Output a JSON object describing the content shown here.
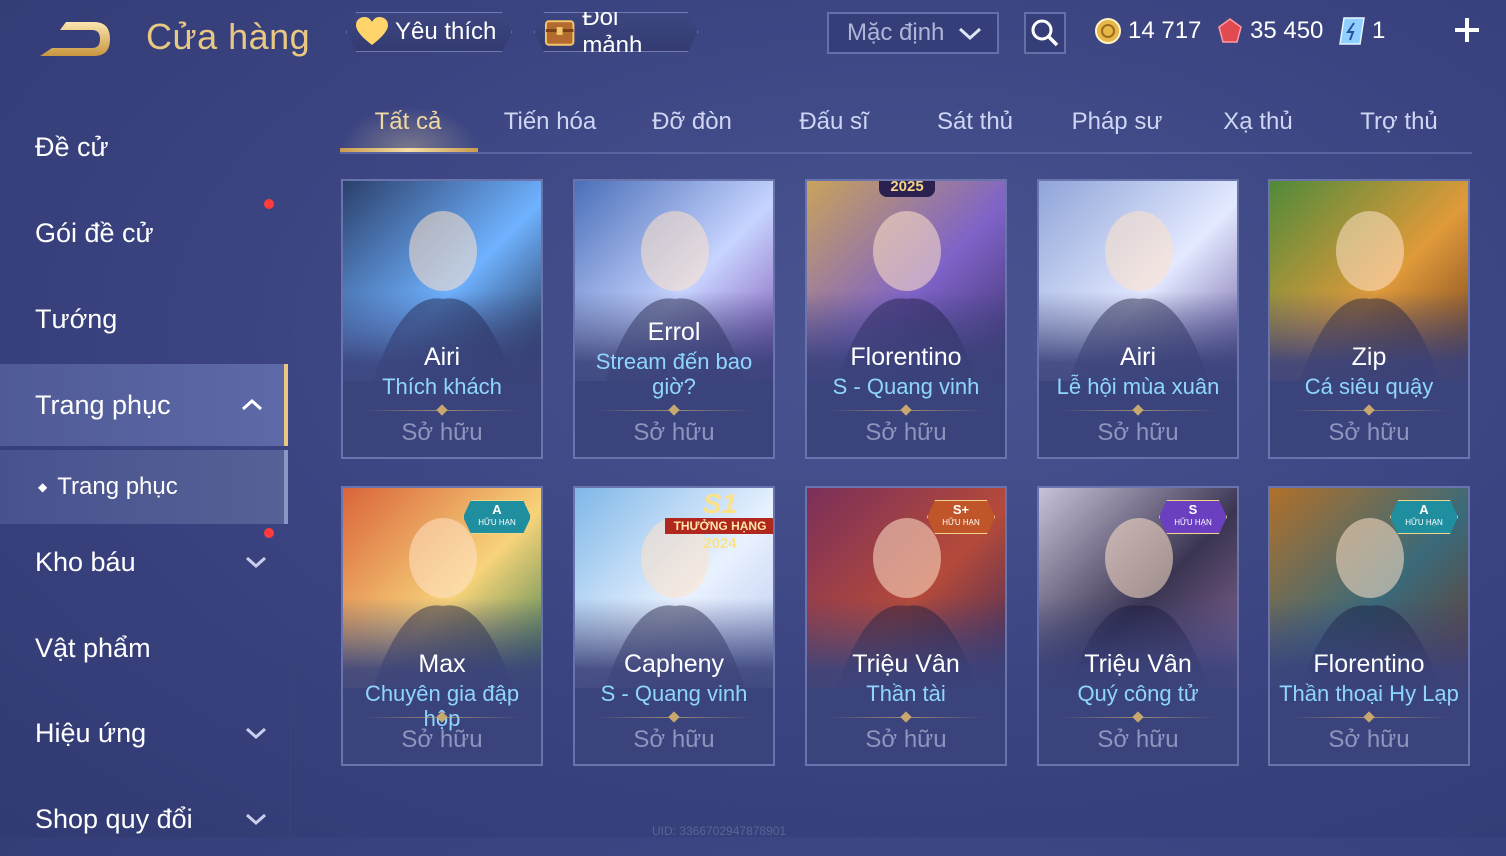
{
  "header": {
    "title": "Cửa hàng",
    "favorites_label": "Yêu thích",
    "exchange_label": "Đổi mảnh",
    "sort": {
      "selected": "Mặc định"
    },
    "currencies": {
      "gold": "14 717",
      "ruby": "35 450",
      "ticket": "1"
    }
  },
  "sidebar": {
    "items": [
      {
        "label": "Đề cử"
      },
      {
        "label": "Gói đề cử"
      },
      {
        "label": "Tướng"
      },
      {
        "label": "Trang phục"
      },
      {
        "label": "Trang phục"
      },
      {
        "label": "Kho báu"
      },
      {
        "label": "Vật phẩm"
      },
      {
        "label": "Hiệu ứng"
      },
      {
        "label": "Shop quy đổi"
      }
    ]
  },
  "tabs": [
    {
      "label": "Tất cả"
    },
    {
      "label": "Tiến hóa"
    },
    {
      "label": "Đỡ đòn"
    },
    {
      "label": "Đấu sĩ"
    },
    {
      "label": "Sát thủ"
    },
    {
      "label": "Pháp sư"
    },
    {
      "label": "Xạ thủ"
    },
    {
      "label": "Trợ thủ"
    }
  ],
  "cards": [
    {
      "hero": "Airi",
      "skin": "Thích khách",
      "status": "Sở hữu",
      "badge": ""
    },
    {
      "hero": "Errol",
      "skin": "Stream đến bao giờ?",
      "status": "Sở hữu",
      "badge": ""
    },
    {
      "hero": "Florentino",
      "skin": "S - Quang vinh",
      "status": "Sở hữu",
      "badge": "2025"
    },
    {
      "hero": "Airi",
      "skin": "Lễ hội mùa xuân",
      "status": "Sở hữu",
      "badge": ""
    },
    {
      "hero": "Zip",
      "skin": "Cá siêu quậy",
      "status": "Sở hữu",
      "badge": ""
    },
    {
      "hero": "Max",
      "skin": "Chuyên gia đập hộp",
      "status": "Sở hữu",
      "badge": "A",
      "badge_sub": "HỮU HẠN"
    },
    {
      "hero": "Capheny",
      "skin": "S - Quang vinh",
      "status": "Sở hữu",
      "badge": "S1",
      "badge_sub": "THƯỞNG HẠNG",
      "badge_year": "2024"
    },
    {
      "hero": "Triệu Vân",
      "skin": "Thần tài",
      "status": "Sở hữu",
      "badge": "S+",
      "badge_sub": "HỮU HẠN"
    },
    {
      "hero": "Triệu Vân",
      "skin": "Quý công tử",
      "status": "Sở hữu",
      "badge": "S",
      "badge_sub": "HỮU HẠN"
    },
    {
      "hero": "Florentino",
      "skin": "Thần thoại Hy Lạp",
      "status": "Sở hữu",
      "badge": "A",
      "badge_sub": "HỮU HẠN"
    }
  ],
  "footer": {
    "uid": "UID: 3366702947878901"
  },
  "colors": {
    "accent_gold": "#e8c882",
    "skin_blue": "#8fd6ff",
    "background": "#3a4380"
  }
}
